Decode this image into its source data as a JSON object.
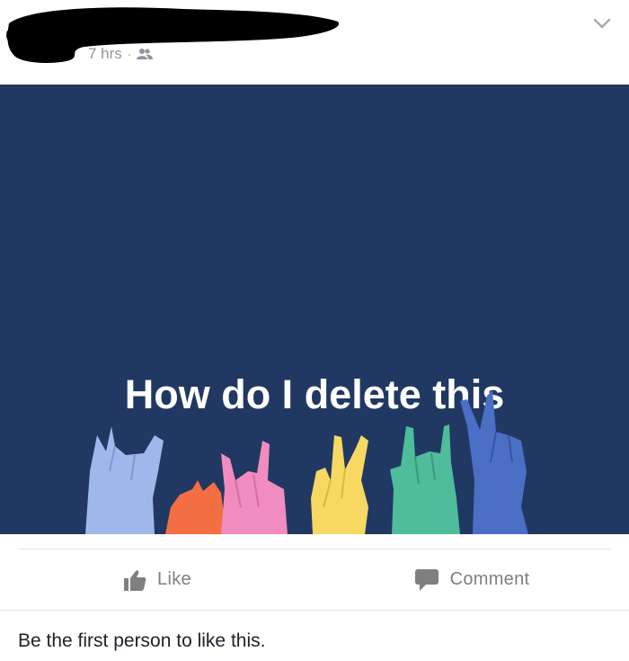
{
  "post": {
    "timestamp": "7 hrs",
    "separator": "·",
    "audience_icon": "friends-icon",
    "menu_icon": "chevron-down-icon"
  },
  "status_card": {
    "text": "How do I delete this",
    "background": "#213862",
    "decoration": "raised-hands-illustration"
  },
  "actions": {
    "like_label": "Like",
    "like_icon": "thumbs-up-icon",
    "comment_label": "Comment",
    "comment_icon": "speech-bubble-icon"
  },
  "likes": {
    "summary": "Be the first person to like this."
  }
}
